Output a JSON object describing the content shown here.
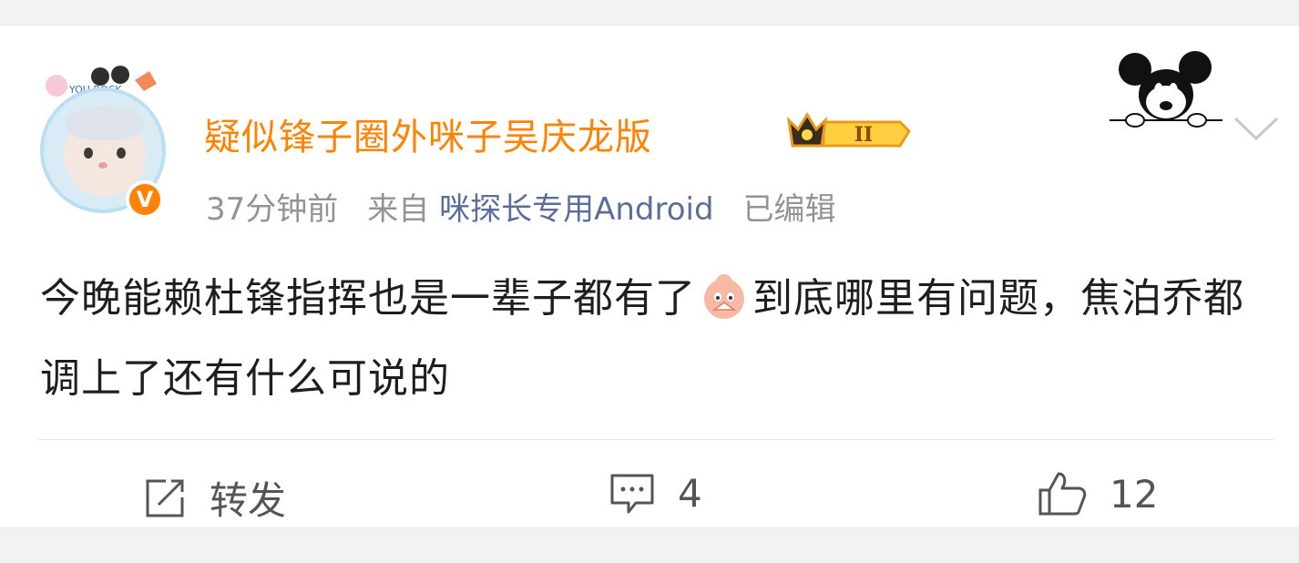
{
  "post": {
    "username": "疑似锋子圈外咪子吴庆龙版",
    "level_badge": "II",
    "timestamp": "37分钟前",
    "source_prefix": "来自",
    "source": "咪探长专用Android",
    "edited": "已编辑",
    "text_part1": "今晚能赖杜锋指挥也是一辈子都有了",
    "text_part2": "到底哪里有问题，焦泊乔都调上了还有什么可说的",
    "avatar_text": "YOU ROCK"
  },
  "actions": {
    "repost_label": "转发",
    "comment_count": "4",
    "like_count": "12"
  },
  "colors": {
    "username": "#ff8200",
    "source_link": "#5b6d99",
    "meta": "#939393",
    "text": "#1e1e1e"
  },
  "icons": [
    "crown-level-icon",
    "mickey-sticker-icon",
    "chevron-down-icon",
    "verified-v-icon",
    "emoji-fan-icon",
    "repost-icon",
    "comment-icon",
    "like-icon"
  ]
}
